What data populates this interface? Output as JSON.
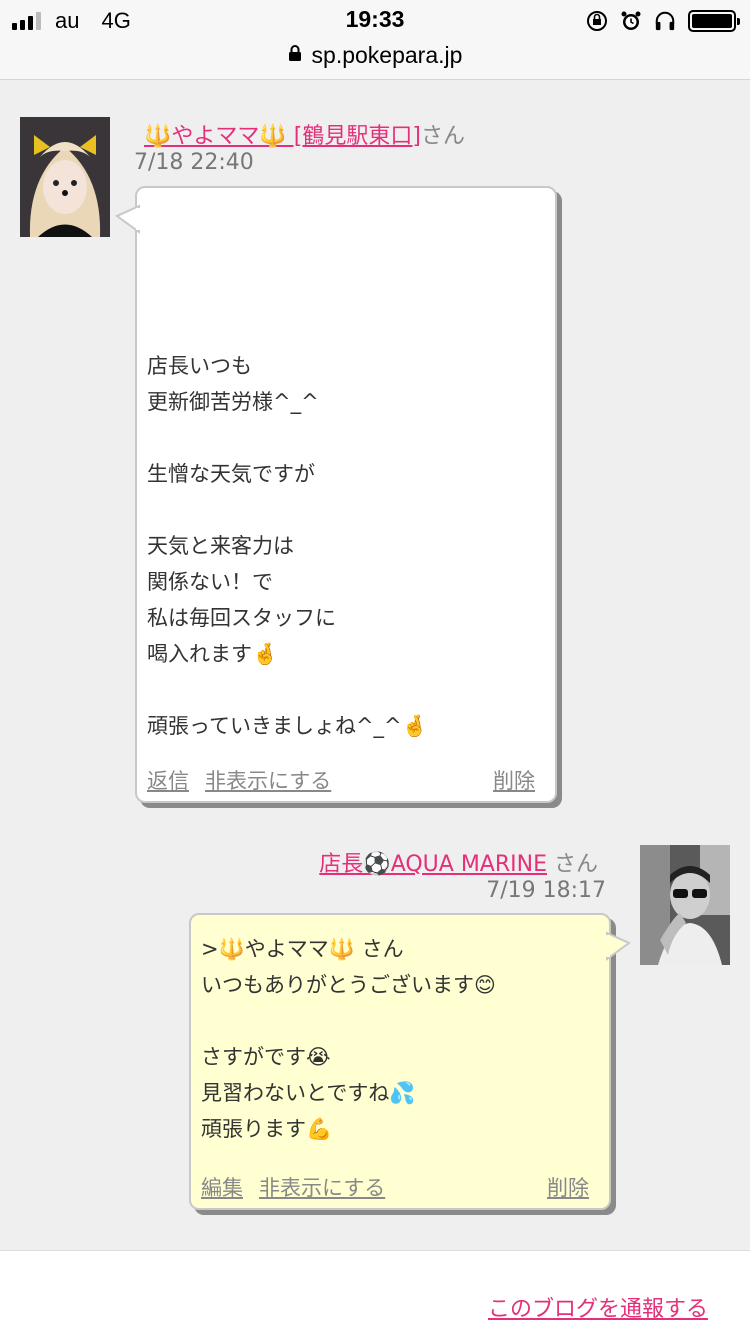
{
  "status_bar": {
    "carrier": "au",
    "network": "4G",
    "time": "19:33",
    "battery_level": 1.0,
    "icons": [
      "signal-icon",
      "rotation-lock-icon",
      "alarm-icon",
      "headphones-icon",
      "battery-icon"
    ]
  },
  "browser": {
    "url": "sp.pokepara.jp",
    "lock_icon": "lock-icon"
  },
  "comments": [
    {
      "author": "🔱やよママ🔱 [鶴見駅東口]",
      "suffix": "さん",
      "time": "7/18 22:40",
      "lines": [
        "",
        "",
        "",
        "",
        "店長いつも",
        "更新御苦労様^_^",
        "",
        "生憎な天気ですが",
        "",
        "天気と来客力は",
        "関係ない！で",
        "私は毎回スタッフに",
        "喝入れます🤞",
        "",
        "頑張っていきましょね^_^🤞"
      ],
      "actions": {
        "reply": "返信",
        "hide": "非表示にする",
        "delete": "削除"
      }
    },
    {
      "author": "店長⚽AQUA MARINE",
      "suffix": "さん",
      "time": "7/19 18:17",
      "lines": [
        ">🔱やよママ🔱 さん",
        "いつもありがとうございます😊",
        "",
        "さすがです😭",
        "見習わないとですね💦",
        "頑張ります💪"
      ],
      "actions": {
        "edit": "編集",
        "hide": "非表示にする",
        "delete": "削除"
      }
    }
  ],
  "footer": {
    "report_link": "このブログを通報する"
  },
  "colors": {
    "link": "#e4307a",
    "bubble_reply": "#ffffd2",
    "background": "#efefef"
  }
}
